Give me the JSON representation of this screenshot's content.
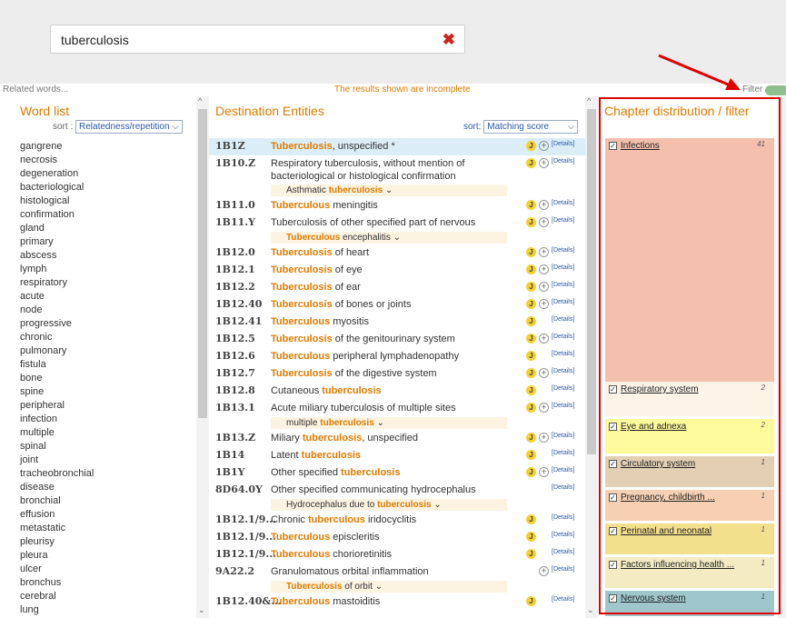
{
  "search": {
    "value": "tuberculosis",
    "clear_icon": "✖"
  },
  "info": {
    "related_words": "Related words...",
    "incomplete": "The results shown are incomplete",
    "filter": "Filter"
  },
  "word_list": {
    "title": "Word list",
    "sort_label": "sort :",
    "sort_value": "Relatedness/repetition ⌵",
    "words": [
      "gangrene",
      "necrosis",
      "degeneration",
      "bacteriological",
      "histological",
      "confirmation",
      "gland",
      "primary",
      "abscess",
      "lymph",
      "respiratory",
      "acute",
      "node",
      "progressive",
      "chronic",
      "pulmonary",
      "fistula",
      "bone",
      "spine",
      "peripheral",
      "infection",
      "multiple",
      "spinal",
      "joint",
      "tracheobronchial",
      "disease",
      "bronchial",
      "effusion",
      "metastatic",
      "pleurisy",
      "pleura",
      "ulcer",
      "bronchus",
      "cerebral",
      "lung"
    ]
  },
  "destination": {
    "title": "Destination Entities",
    "sort_label": "sort:",
    "sort_value": "Matching score",
    "details_label": "[Details]",
    "j_label": "J",
    "plus_label": "+",
    "rows": [
      {
        "code": "1B1Z",
        "pre": "",
        "hl": "Tuberculosis",
        "post": ", unspecified *",
        "j": true,
        "plus": true,
        "highlight": true,
        "sub_pre": "",
        "sub_hl": "",
        "sub_post": ""
      },
      {
        "code": "1B10.Z",
        "pre": "Respiratory tuberculosis, without mention of bacteriological or histological confirmation",
        "hl": "",
        "post": "",
        "j": true,
        "plus": true,
        "sub_pre": "Asthmatic ",
        "sub_hl": "tuberculosis",
        "sub_post": " ⌄"
      },
      {
        "code": "1B11.0",
        "pre": "",
        "hl": "Tuberculous",
        "post": " meningitis",
        "j": true,
        "plus": true,
        "sub_pre": "",
        "sub_hl": "",
        "sub_post": ""
      },
      {
        "code": "1B11.Y",
        "pre": "Tuberculosis of other specified part of nervous system",
        "hl": "",
        "post": "",
        "j": true,
        "plus": true,
        "sub_pre": "",
        "sub_hl": "Tuberculous",
        "sub_post": " encephalitis ⌄"
      },
      {
        "code": "1B12.0",
        "pre": "",
        "hl": "Tuberculosis",
        "post": " of heart",
        "j": true,
        "plus": true,
        "sub_pre": "",
        "sub_hl": "",
        "sub_post": ""
      },
      {
        "code": "1B12.1",
        "pre": "",
        "hl": "Tuberculosis",
        "post": " of eye",
        "j": true,
        "plus": true,
        "sub_pre": "",
        "sub_hl": "",
        "sub_post": ""
      },
      {
        "code": "1B12.2",
        "pre": "",
        "hl": "Tuberculosis",
        "post": " of ear",
        "j": true,
        "plus": true,
        "sub_pre": "",
        "sub_hl": "",
        "sub_post": ""
      },
      {
        "code": "1B12.40",
        "pre": "",
        "hl": "Tuberculosis",
        "post": " of bones or joints",
        "j": true,
        "plus": true,
        "sub_pre": "",
        "sub_hl": "",
        "sub_post": ""
      },
      {
        "code": "1B12.41",
        "pre": "",
        "hl": "Tuberculous",
        "post": " myositis",
        "j": true,
        "plus": false,
        "sub_pre": "",
        "sub_hl": "",
        "sub_post": ""
      },
      {
        "code": "1B12.5",
        "pre": "",
        "hl": "Tuberculosis",
        "post": " of the genitourinary system",
        "j": true,
        "plus": true,
        "sub_pre": "",
        "sub_hl": "",
        "sub_post": ""
      },
      {
        "code": "1B12.6",
        "pre": "",
        "hl": "Tuberculous",
        "post": " peripheral lymphadenopathy",
        "j": true,
        "plus": false,
        "sub_pre": "",
        "sub_hl": "",
        "sub_post": ""
      },
      {
        "code": "1B12.7",
        "pre": "",
        "hl": "Tuberculosis",
        "post": " of the digestive system",
        "j": true,
        "plus": true,
        "sub_pre": "",
        "sub_hl": "",
        "sub_post": ""
      },
      {
        "code": "1B12.8",
        "pre": "Cutaneous ",
        "hl": "tuberculosis",
        "post": "",
        "j": true,
        "plus": false,
        "sub_pre": "",
        "sub_hl": "",
        "sub_post": ""
      },
      {
        "code": "1B13.1",
        "pre": "Acute miliary tuberculosis of multiple sites",
        "hl": "",
        "post": "",
        "j": true,
        "plus": true,
        "sub_pre": "multiple ",
        "sub_hl": "tuberculosis",
        "sub_post": " ⌄"
      },
      {
        "code": "1B13.Z",
        "pre": "Miliary ",
        "hl": "tuberculosis",
        "post": ", unspecified",
        "j": true,
        "plus": true,
        "sub_pre": "",
        "sub_hl": "",
        "sub_post": ""
      },
      {
        "code": "1B14",
        "pre": "Latent ",
        "hl": "tuberculosis",
        "post": "",
        "j": true,
        "plus": false,
        "sub_pre": "",
        "sub_hl": "",
        "sub_post": ""
      },
      {
        "code": "1B1Y",
        "pre": "Other specified ",
        "hl": "tuberculosis",
        "post": "",
        "j": true,
        "plus": true,
        "sub_pre": "",
        "sub_hl": "",
        "sub_post": ""
      },
      {
        "code": "8D64.0Y",
        "pre": "Other specified communicating hydrocephalus",
        "hl": "",
        "post": "",
        "j": false,
        "plus": false,
        "sub_pre": "Hydrocephalus due to ",
        "sub_hl": "tuberculosis",
        "sub_post": " ⌄"
      },
      {
        "code": "1B12.1/9...",
        "pre": "Chronic ",
        "hl": "tuberculous",
        "post": " iridocyclitis",
        "j": true,
        "plus": false,
        "sub_pre": "",
        "sub_hl": "",
        "sub_post": ""
      },
      {
        "code": "1B12.1/9...",
        "pre": "",
        "hl": "Tuberculous",
        "post": " episcleritis",
        "j": true,
        "plus": false,
        "sub_pre": "",
        "sub_hl": "",
        "sub_post": ""
      },
      {
        "code": "1B12.1/9...",
        "pre": "",
        "hl": "Tuberculous",
        "post": " chorioretinitis",
        "j": true,
        "plus": false,
        "sub_pre": "",
        "sub_hl": "",
        "sub_post": ""
      },
      {
        "code": "9A22.2",
        "pre": "Granulomatous orbital inflammation",
        "hl": "",
        "post": "",
        "j": false,
        "plus": true,
        "sub_pre": "",
        "sub_hl": "Tuberculosis",
        "sub_post": " of orbit ⌄"
      },
      {
        "code": "1B12.40&...",
        "pre": "",
        "hl": "Tuberculous",
        "post": " mastoiditis",
        "j": true,
        "plus": false,
        "sub_pre": "",
        "sub_hl": "",
        "sub_post": ""
      }
    ]
  },
  "chapters": {
    "title": "Chapter distribution / filter",
    "check": "✓",
    "items": [
      {
        "name": "Infections",
        "count": "41",
        "color": "#f5bfae"
      },
      {
        "name": "Respiratory system",
        "count": "2",
        "color": "#fdf3e6"
      },
      {
        "name": "Eye and adnexa",
        "count": "2",
        "color": "#fdfa9c"
      },
      {
        "name": "Circulatory system",
        "count": "1",
        "color": "#e3cfb3"
      },
      {
        "name": "Pregnancy, childbirth ...",
        "count": "1",
        "color": "#f7d0b4"
      },
      {
        "name": "Perinatal and neonatal",
        "count": "1",
        "color": "#f3e08d"
      },
      {
        "name": "Factors influencing health ...",
        "count": "1",
        "color": "#f4ebc3"
      },
      {
        "name": "Nervous system",
        "count": "1",
        "color": "#9fc6cd"
      }
    ]
  },
  "colors": {
    "accent": "#e07b00",
    "link": "#2a5aa8",
    "annotation": "#e00000"
  }
}
